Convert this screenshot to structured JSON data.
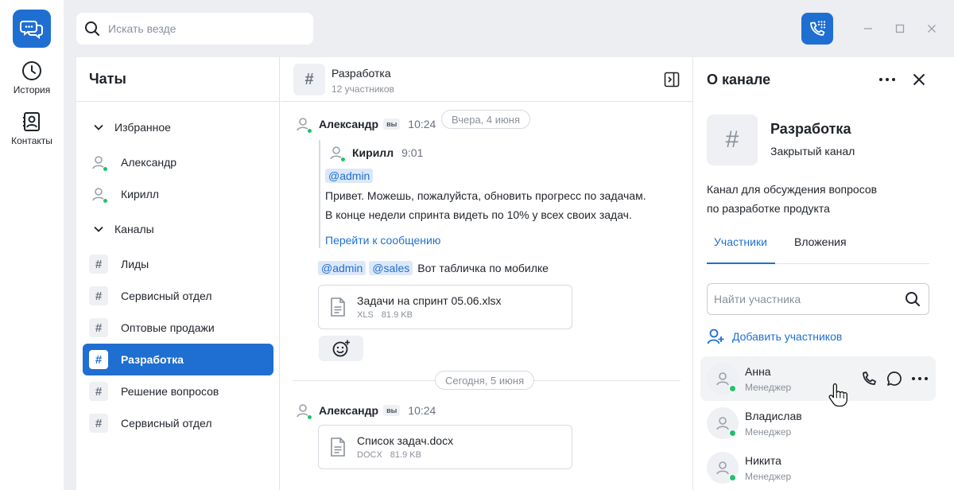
{
  "rail": {
    "items": [
      {
        "label": "История",
        "icon": "clock-icon"
      },
      {
        "label": "Контакты",
        "icon": "contacts-icon"
      }
    ]
  },
  "search": {
    "placeholder": "Искать везде"
  },
  "chats": {
    "title": "Чаты",
    "favorites_label": "Избранное",
    "favorites": [
      {
        "name": "Александр",
        "online": true
      },
      {
        "name": "Кирилл",
        "online": true
      }
    ],
    "channels_label": "Каналы",
    "channels": [
      {
        "name": "Лиды",
        "active": false
      },
      {
        "name": "Сервисный отдел",
        "active": false
      },
      {
        "name": "Оптовые продажи",
        "active": false
      },
      {
        "name": "Разработка",
        "active": true
      },
      {
        "name": "Решение вопросов",
        "active": false
      },
      {
        "name": "Сервисный отдел",
        "active": false
      }
    ]
  },
  "conversation": {
    "title": "Разработка",
    "subtitle": "12 участников",
    "date_yesterday": "Вчера, 4 июня",
    "date_today": "Сегодня, 5 июня",
    "message1": {
      "author": "Александр",
      "you_badge": "вы",
      "time": "10:24",
      "quote": {
        "author": "Кирилл",
        "time": "9:01",
        "mention": "@admin",
        "line1": "Привет. Можешь, пожалуйста, обновить прогресс по задачам.",
        "line2": "В конце недели спринта видеть по 10% у всех своих задач.",
        "link": "Перейти к сообщению"
      },
      "mention1": "@admin",
      "mention2": "@sales",
      "text": "Вот табличка по мобилке",
      "file": {
        "name": "Задачи на спринт 05.06.xlsx",
        "type": "XLS",
        "size": "81.9 KB"
      }
    },
    "message2": {
      "author": "Александр",
      "you_badge": "вы",
      "time": "10:24",
      "file": {
        "name": "Список задач.docx",
        "type": "DOCX",
        "size": "81.9 KB"
      }
    }
  },
  "info": {
    "title": "О канале",
    "channel_name": "Разработка",
    "channel_type": "Закрытый канал",
    "description_line1": "Канал для обсуждения вопросов",
    "description_line2": "по разработке продукта",
    "tabs": [
      {
        "label": "Участники",
        "active": true
      },
      {
        "label": "Вложения",
        "active": false
      }
    ],
    "member_search_placeholder": "Найти участника",
    "add_members_label": "Добавить участников",
    "members": [
      {
        "name": "Анна",
        "role": "Менеджер",
        "online": true
      },
      {
        "name": "Владислав",
        "role": "Менеджер",
        "online": true
      },
      {
        "name": "Никита",
        "role": "Менеджер",
        "online": true
      }
    ]
  },
  "colors": {
    "accent": "#1f6fd2",
    "online": "#21c16b",
    "background": "#eceef1"
  }
}
